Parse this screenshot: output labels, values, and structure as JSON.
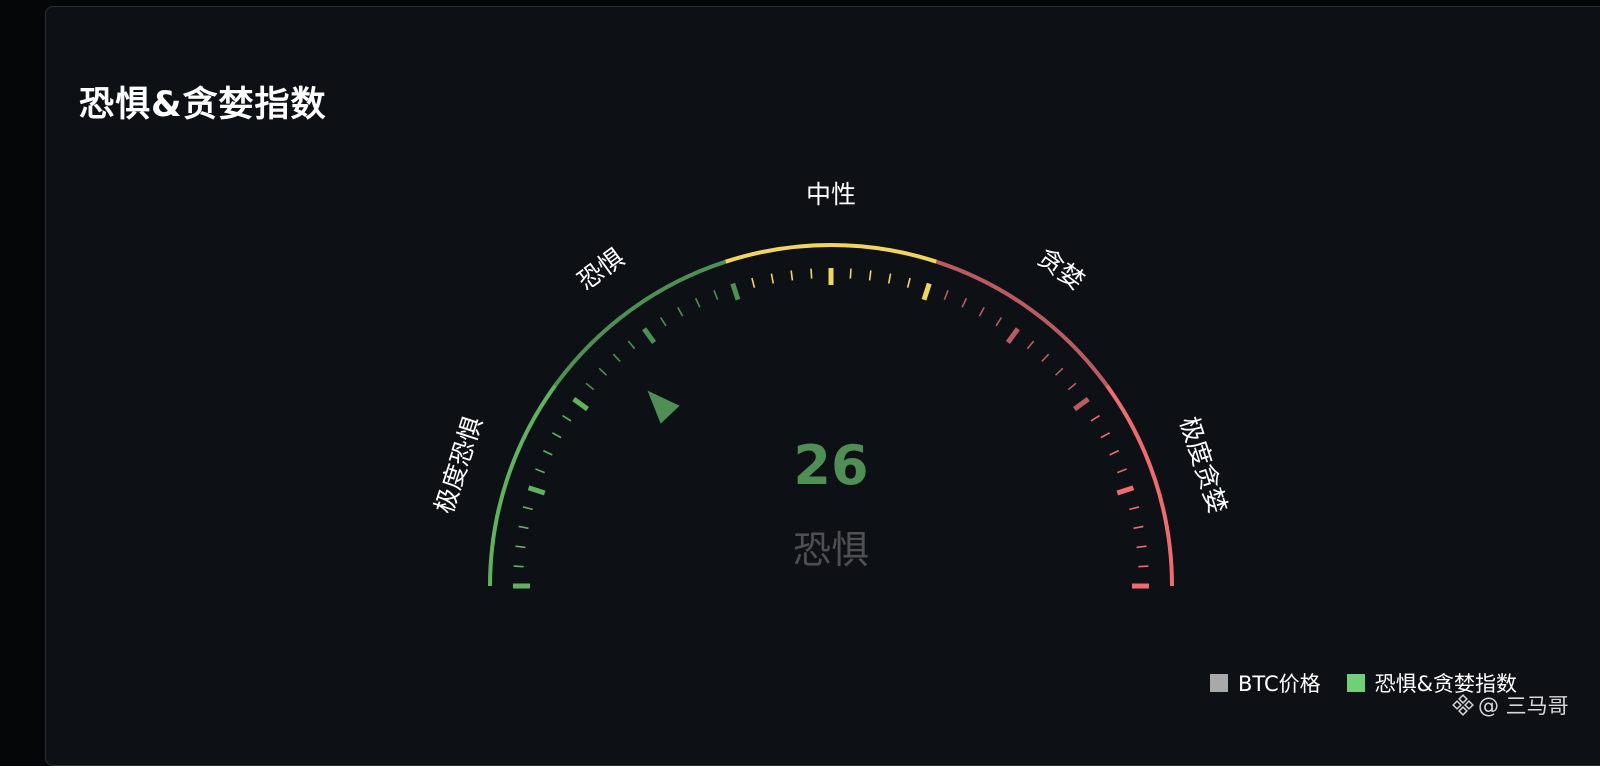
{
  "page": {
    "title": "恐惧&贪婪指数"
  },
  "gauge": {
    "value": 26,
    "min": 0,
    "max": 100,
    "status_label": "恐惧",
    "zones": [
      {
        "name": "极度恐惧",
        "from": 0,
        "to": 20,
        "color": "#5fb35f"
      },
      {
        "name": "恐惧",
        "from": 20,
        "to": 40,
        "color": "#4e8f55"
      },
      {
        "name": "中性",
        "from": 40,
        "to": 60,
        "color": "#f2d462"
      },
      {
        "name": "贪婪",
        "from": 60,
        "to": 80,
        "color": "#b85c61"
      },
      {
        "name": "极度贪婪",
        "from": 80,
        "to": 100,
        "color": "#ee6b70"
      }
    ],
    "value_color": "#4f8f55",
    "status_color": "#4d4f52",
    "pointer_color": "#4f8f55"
  },
  "legend": [
    {
      "label": "BTC价格",
      "color": "#a9a9a9"
    },
    {
      "label": "恐惧&贪婪指数",
      "color": "#6fd07a"
    }
  ],
  "watermark": {
    "text": "@ 三马哥"
  }
}
